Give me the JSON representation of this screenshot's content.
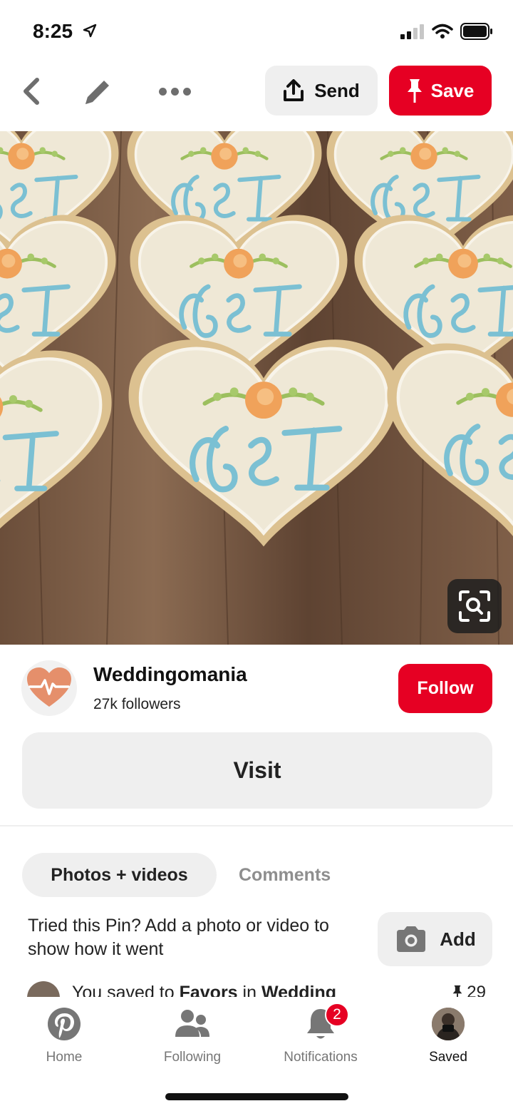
{
  "status_bar": {
    "time": "8:25"
  },
  "toolbar": {
    "send_label": "Send",
    "save_label": "Save"
  },
  "pin": {
    "image_label": "G&T"
  },
  "creator": {
    "name": "Weddingomania",
    "followers": "27k followers",
    "follow_label": "Follow"
  },
  "visit_label": "Visit",
  "tabs": {
    "photos": "Photos + videos",
    "comments": "Comments"
  },
  "tried": {
    "text": "Tried this Pin? Add a photo or video to show how it went",
    "add_label": "Add"
  },
  "saved": {
    "prefix": "You saved to ",
    "board": "Favors",
    "mid": " in ",
    "section": "Wedding",
    "count": "29"
  },
  "nav": {
    "items": [
      {
        "label": "Home"
      },
      {
        "label": "Following"
      },
      {
        "label": "Notifications",
        "badge": "2"
      },
      {
        "label": "Saved"
      }
    ]
  },
  "colors": {
    "brand_red": "#e60023",
    "button_gray": "#efefef"
  }
}
